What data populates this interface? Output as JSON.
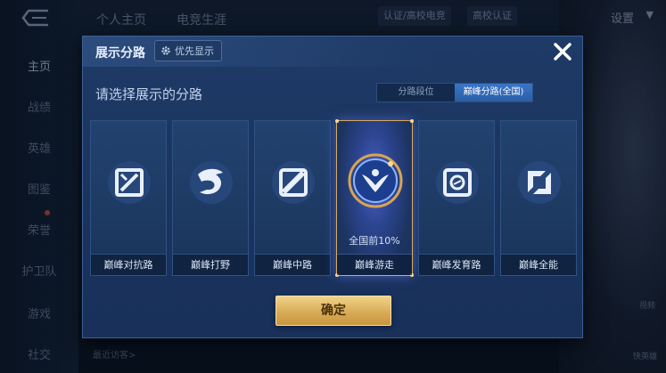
{
  "background": {
    "top_tabs": [
      "个人主页",
      "电竞生涯"
    ],
    "top_pills": [
      "认证/高校电竞",
      "高校认证"
    ],
    "settings_label": "设置",
    "sidebar_items": [
      "主页",
      "战绩",
      "英雄",
      "图鉴",
      "荣誉",
      "护卫队",
      "游戏",
      "社交"
    ],
    "recent_visitors": "最近访客>",
    "right_labels": [
      "视频",
      "快英雄"
    ]
  },
  "modal": {
    "title": "展示分路",
    "priority_label": "优先显示",
    "subtitle": "请选择展示的分路",
    "toggle": {
      "options": [
        "分路段位",
        "巅峰分路(全国)"
      ],
      "selected": "巅峰分路(全国)"
    },
    "lanes": [
      {
        "label": "巅峰对抗路",
        "icon": "clash-lane-icon",
        "selected": false,
        "rank": ""
      },
      {
        "label": "巅峰打野",
        "icon": "jungle-icon",
        "selected": false,
        "rank": ""
      },
      {
        "label": "巅峰中路",
        "icon": "mid-lane-icon",
        "selected": false,
        "rank": ""
      },
      {
        "label": "巅峰游走",
        "icon": "roam-icon",
        "selected": true,
        "rank": "全国前10%"
      },
      {
        "label": "巅峰发育路",
        "icon": "farm-lane-icon",
        "selected": false,
        "rank": ""
      },
      {
        "label": "巅峰全能",
        "icon": "all-round-icon",
        "selected": false,
        "rank": ""
      }
    ],
    "confirm_label": "确定"
  },
  "colors": {
    "modal_bg": "#1e3a66",
    "toggle_active": "#3a76c6",
    "selected_border": "#d8a863",
    "confirm_gold": "#d9ac56"
  }
}
